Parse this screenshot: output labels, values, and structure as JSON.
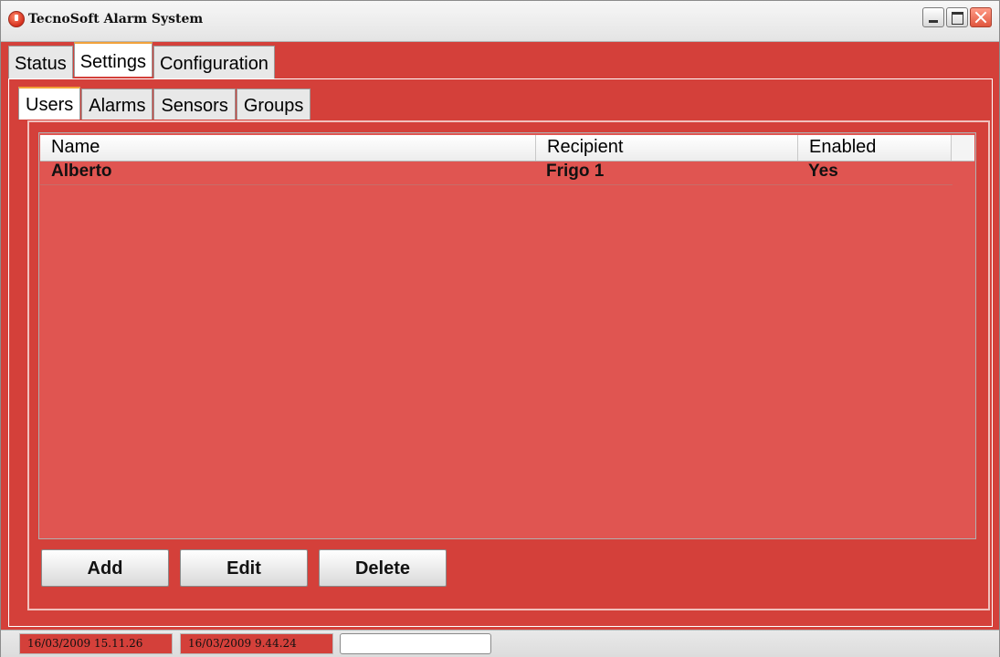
{
  "window": {
    "title": "TecnoSoft Alarm System"
  },
  "top_tabs": [
    {
      "label": "Status",
      "active": false
    },
    {
      "label": "Settings",
      "active": true
    },
    {
      "label": "Configuration",
      "active": false
    }
  ],
  "inner_tabs": [
    {
      "label": "Users",
      "active": true
    },
    {
      "label": "Alarms",
      "active": false
    },
    {
      "label": "Sensors",
      "active": false
    },
    {
      "label": "Groups",
      "active": false
    }
  ],
  "users_table": {
    "columns": [
      "Name",
      "Recipient",
      "Enabled"
    ],
    "rows": [
      {
        "name": "Alberto",
        "recipient": "Frigo 1",
        "enabled": "Yes"
      }
    ]
  },
  "buttons": {
    "add": "Add",
    "edit": "Edit",
    "delete": "Delete"
  },
  "statusbar": {
    "timestamp_1": "16/03/2009 15.11.26",
    "timestamp_2": "16/03/2009 9.44.24"
  },
  "colors": {
    "window_background": "#d4403a",
    "table_background": "#e05551",
    "active_tab_accent": "#f2a23a"
  },
  "icons": {
    "app": "alarm-app-icon",
    "minimize": "minimize-icon",
    "maximize": "maximize-icon",
    "close": "close-icon"
  }
}
